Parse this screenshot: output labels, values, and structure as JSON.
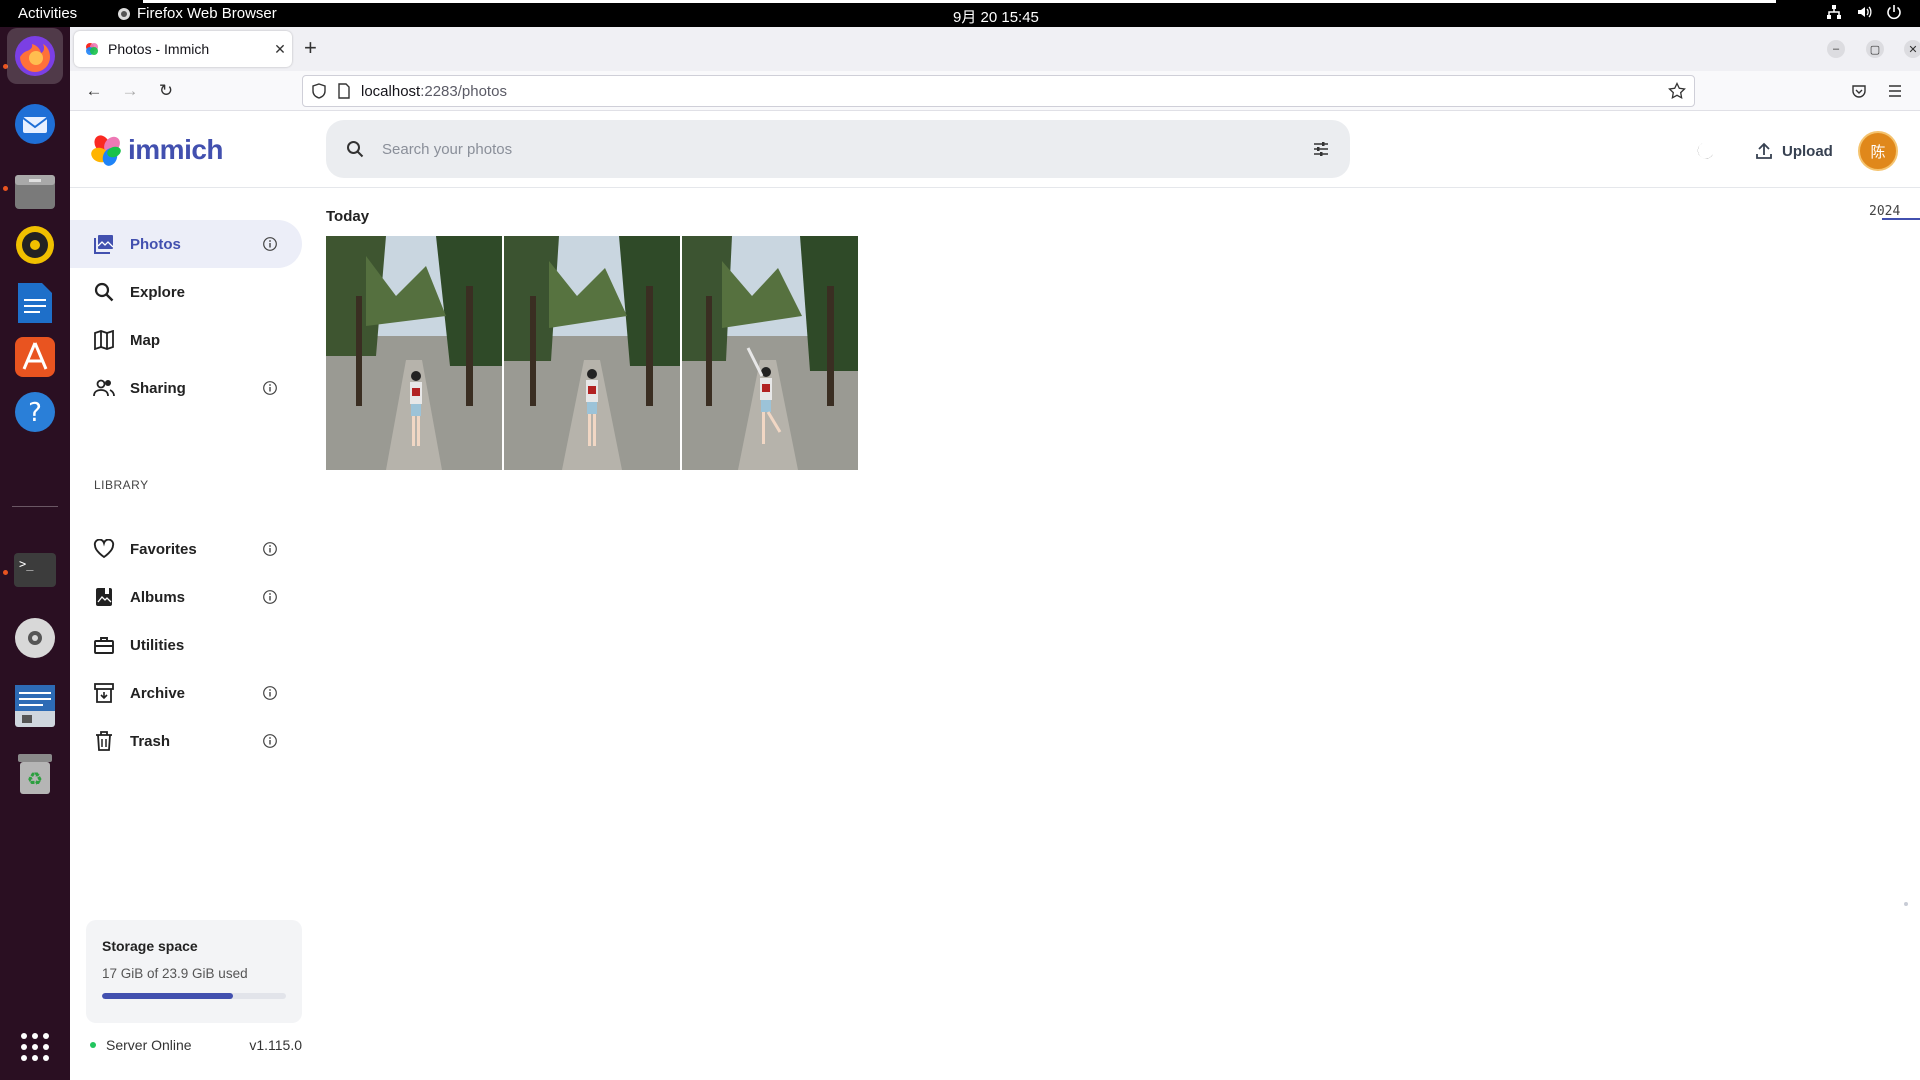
{
  "system": {
    "activities": "Activities",
    "focused_app": "Firefox Web Browser",
    "clock": "9月 20  15:45"
  },
  "browser": {
    "tab_title": "Photos - Immich",
    "url_host": "localhost",
    "url_path": ":2283/photos"
  },
  "app": {
    "logo_text": "immich",
    "search_placeholder": "Search your photos",
    "upload_label": "Upload",
    "avatar_initial": "陈"
  },
  "sidebar": {
    "items": [
      {
        "label": "Photos"
      },
      {
        "label": "Explore"
      },
      {
        "label": "Map"
      },
      {
        "label": "Sharing"
      }
    ],
    "library_label": "LIBRARY",
    "library_items": [
      {
        "label": "Favorites"
      },
      {
        "label": "Albums"
      },
      {
        "label": "Utilities"
      },
      {
        "label": "Archive"
      },
      {
        "label": "Trash"
      }
    ],
    "storage": {
      "title": "Storage space",
      "used_text": "17 GiB of 23.9 GiB used",
      "used_fraction": 0.71
    },
    "server_status": "Server Online",
    "server_version": "v1.115.0"
  },
  "timeline": {
    "group_title": "Today",
    "photo_count": 3,
    "year_marker": "2024"
  },
  "colors": {
    "accent": "#4250af",
    "avatar": "#e0881b",
    "online": "#22c55e"
  }
}
